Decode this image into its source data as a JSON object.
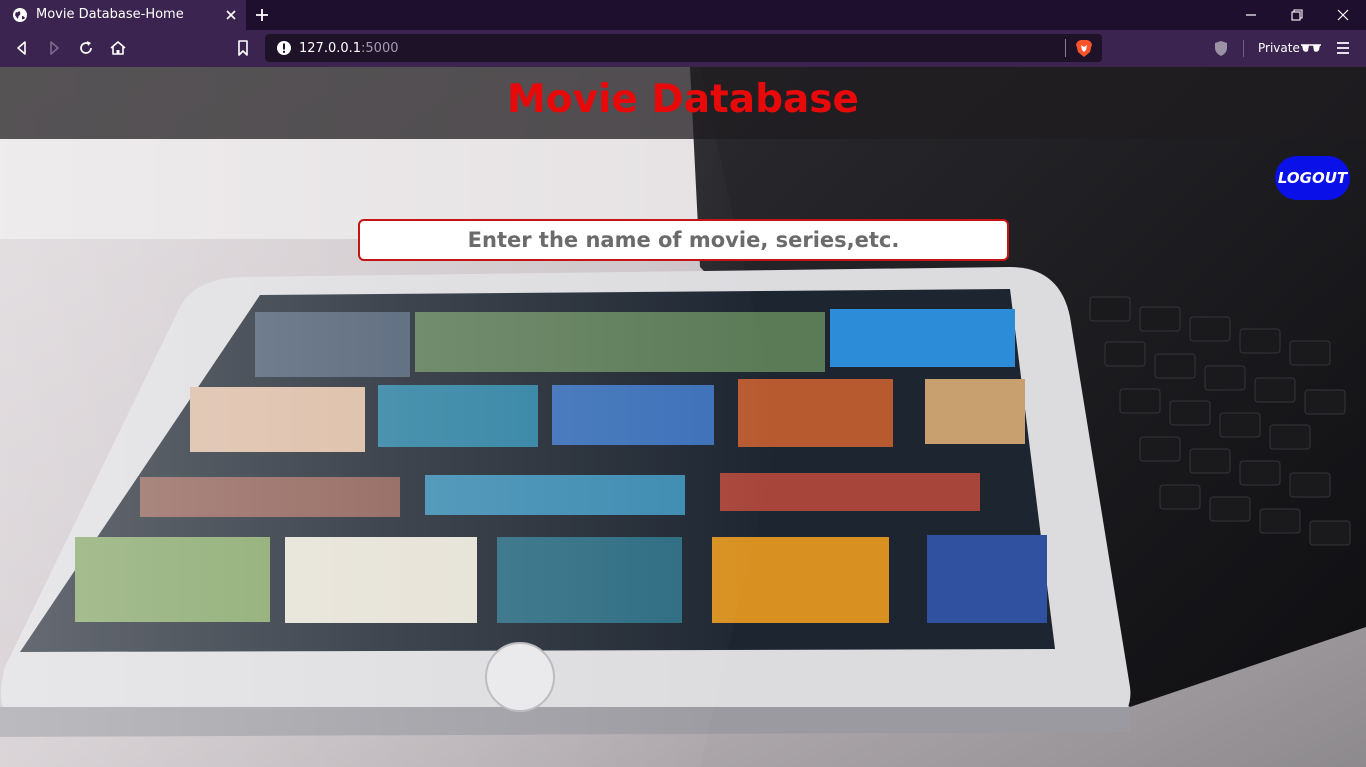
{
  "browser": {
    "tab": {
      "title": "Movie Database-Home",
      "favicon": "globe-icon",
      "close_icon": "close-icon"
    },
    "new_tab_icon": "plus-icon",
    "window_controls": [
      "minimize-icon",
      "restore-icon",
      "close-icon"
    ],
    "nav": [
      "back-icon",
      "forward-icon",
      "reload-icon",
      "home-icon",
      "bookmark-icon"
    ],
    "url": {
      "host": "127.0.0.1",
      "port": ":5000",
      "info_icon": "info-icon"
    },
    "brave_icon": "brave-lion-icon",
    "shield_icon": "shield-icon",
    "private_label": "Private",
    "private_icon": "glasses-icon",
    "menu_icon": "hamburger-menu-icon",
    "colors": {
      "tabstrip": "#1f0f2e",
      "toolbar": "#3b2550",
      "urlbar": "#1d1228"
    }
  },
  "page": {
    "title": "Movie Database",
    "logout_label": "LOGOUT",
    "search": {
      "value": "",
      "placeholder": "Enter the name of movie, series,etc."
    },
    "background": "tablet-with-movie-library-photo",
    "colors": {
      "title": "#e80a0a",
      "logout_bg": "#0a10e8",
      "search_border": "#c41414",
      "header_band": "#1e1c1e"
    }
  }
}
